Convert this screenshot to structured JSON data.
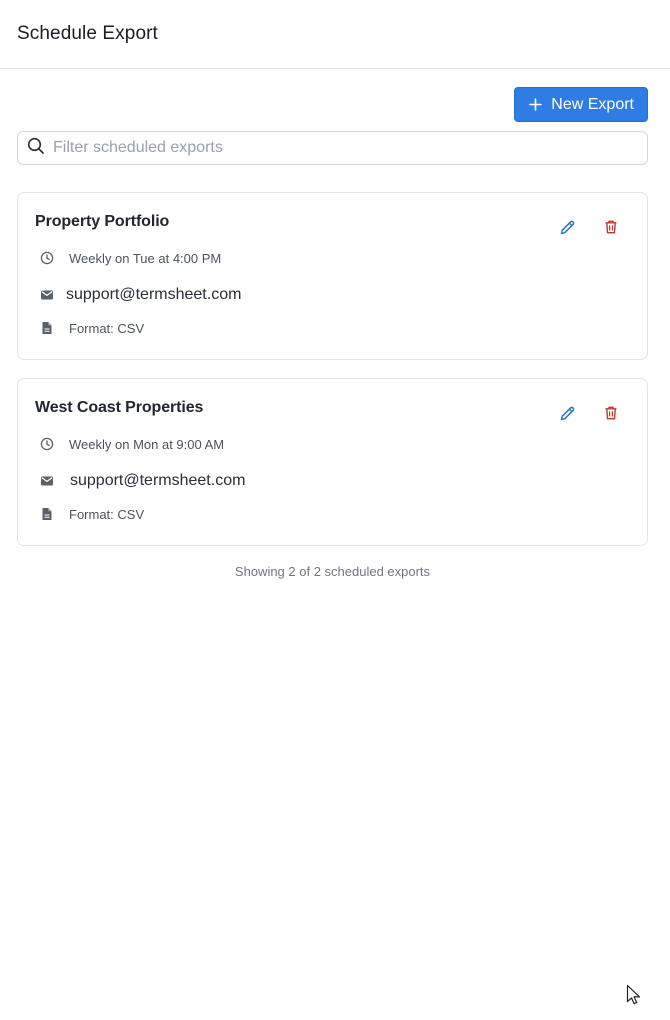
{
  "header": {
    "title": "Schedule Export"
  },
  "toolbar": {
    "new_export_label": "New Export"
  },
  "search": {
    "placeholder": "Filter scheduled exports",
    "value": ""
  },
  "exports": [
    {
      "name": "Property Portfolio",
      "schedule": "Weekly on Tue at 4:00 PM",
      "email": "support@termsheet.com",
      "format": "Format: CSV"
    },
    {
      "name": "West Coast Properties",
      "schedule": "Weekly on Mon at 9:00 AM",
      "email": "support@termsheet.com",
      "format": "Format: CSV"
    }
  ],
  "footer": {
    "count_text": "Showing 2 of 2 scheduled exports"
  },
  "colors": {
    "primary": "#2f7ce5",
    "edit": "#2f73c9",
    "delete": "#c0392b"
  },
  "icons": {
    "add": "plus-icon",
    "search": "search-icon",
    "edit": "pencil-icon",
    "delete": "trash-icon",
    "schedule": "clock-icon",
    "email": "mail-icon",
    "format": "file-icon"
  }
}
